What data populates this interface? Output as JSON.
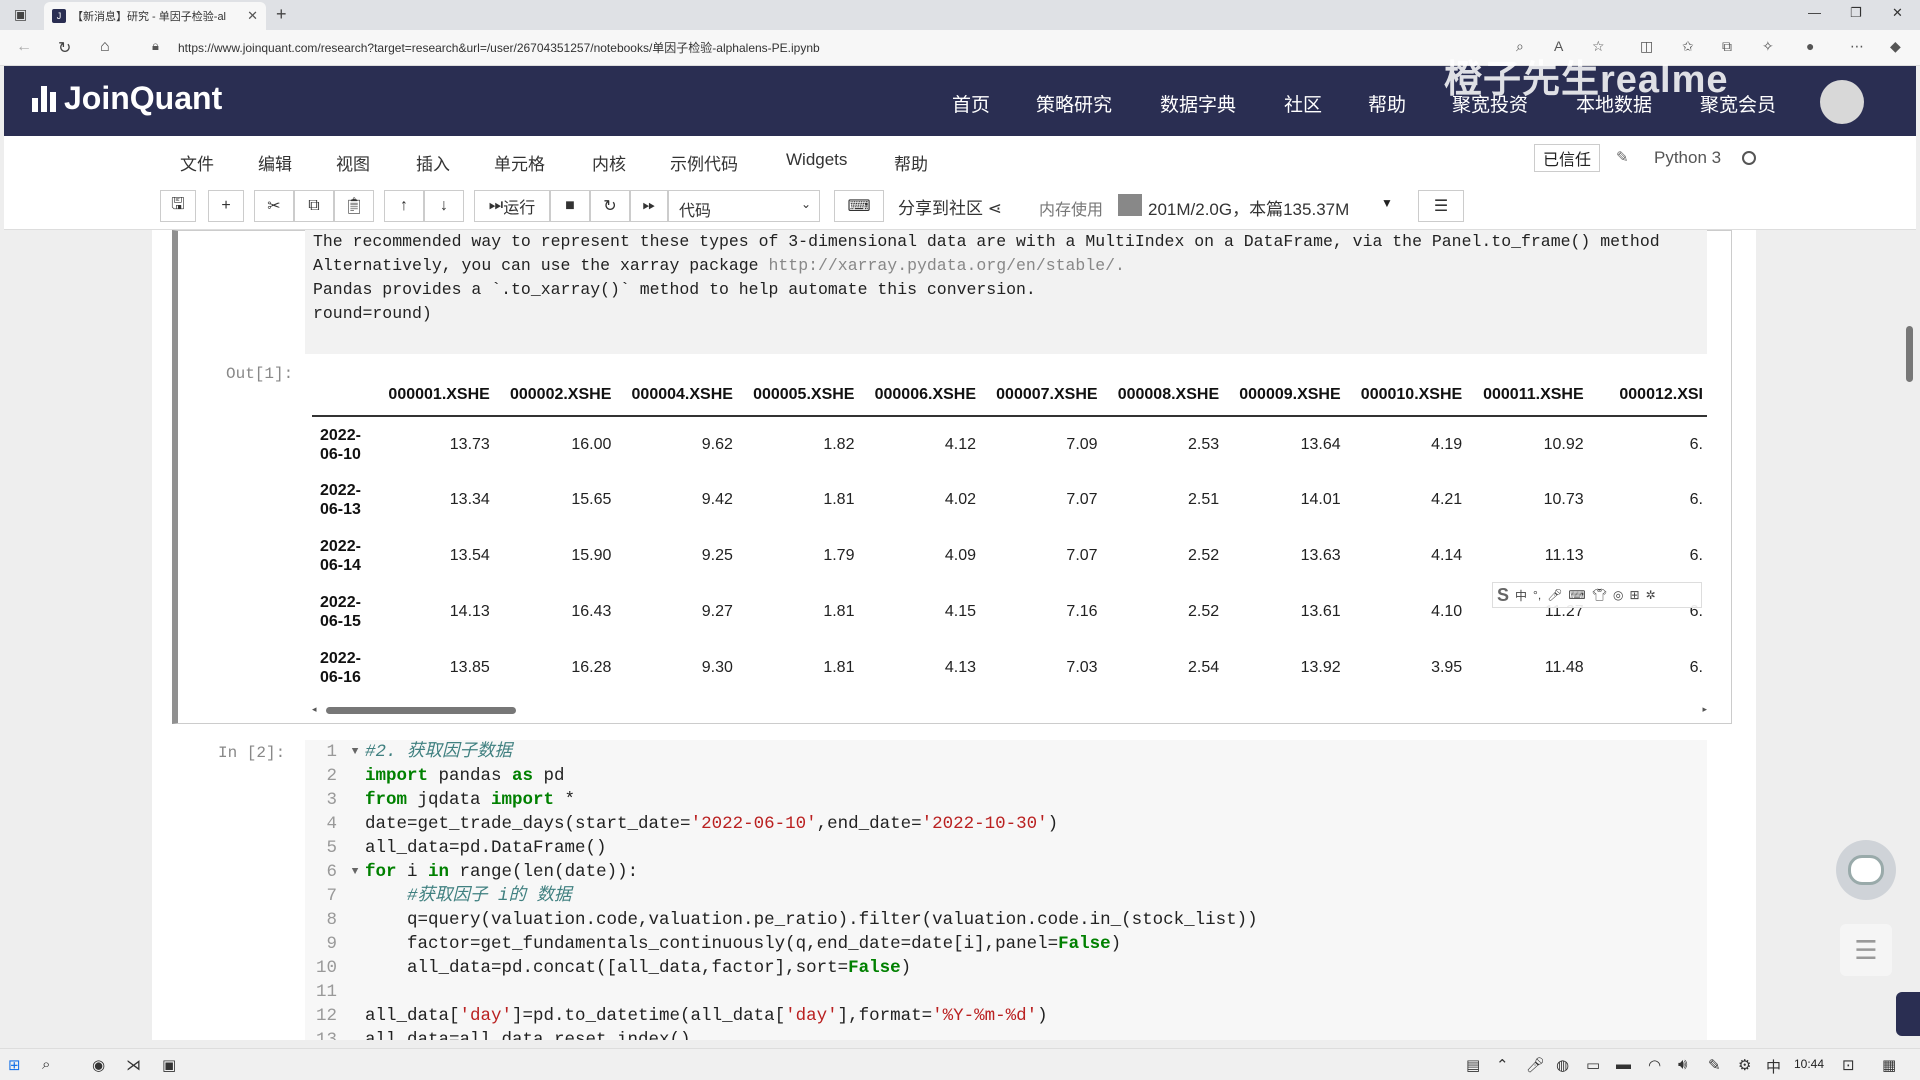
{
  "browser": {
    "tab_title": "【新消息】研究 - 单因子检验-al",
    "url": "https://www.joinquant.com/research?target=research&url=/user/26704351257/notebooks/单因子检验-alphalens-PE.ipynb"
  },
  "site": {
    "logo": "JoinQuant",
    "nav": [
      "首页",
      "策略研究",
      "数据字典",
      "社区",
      "帮助",
      "聚宽投资",
      "本地数据",
      "聚宽会员"
    ],
    "watermark": "橙子先生realme"
  },
  "menubar": {
    "items": [
      "文件",
      "编辑",
      "视图",
      "插入",
      "单元格",
      "内核",
      "示例代码",
      "Widgets",
      "帮助"
    ],
    "trusted": "已信任",
    "kernel": "Python 3"
  },
  "toolbar": {
    "run_label": "运行",
    "cell_type": "代码",
    "share_label": "分享到社区",
    "mem_label": "内存使用",
    "mem_value": "201M/2.0G，本篇135.37M"
  },
  "cell1": {
    "stderr_lines": [
      "The recommended way to represent these types of 3-dimensional data are with a MultiIndex on a DataFrame, via the Panel.to_frame() method",
      "Alternatively, you can use the xarray package ",
      "Pandas provides a `.to_xarray()` method to help automate this conversion."
    ],
    "stderr_url": "http://xarray.pydata.org/en/stable/.",
    "stderr_tail": "  round=round)",
    "out_prompt": "Out[1]:",
    "columns": [
      "000001.XSHE",
      "000002.XSHE",
      "000004.XSHE",
      "000005.XSHE",
      "000006.XSHE",
      "000007.XSHE",
      "000008.XSHE",
      "000009.XSHE",
      "000010.XSHE",
      "000011.XSHE",
      "000012.XSI"
    ],
    "rows": [
      {
        "date1": "2022-",
        "date2": "06-10",
        "values": [
          "13.73",
          "16.00",
          "9.62",
          "1.82",
          "4.12",
          "7.09",
          "2.53",
          "13.64",
          "4.19",
          "10.92",
          "6."
        ]
      },
      {
        "date1": "2022-",
        "date2": "06-13",
        "values": [
          "13.34",
          "15.65",
          "9.42",
          "1.81",
          "4.02",
          "7.07",
          "2.51",
          "14.01",
          "4.21",
          "10.73",
          "6."
        ]
      },
      {
        "date1": "2022-",
        "date2": "06-14",
        "values": [
          "13.54",
          "15.90",
          "9.25",
          "1.79",
          "4.09",
          "7.07",
          "2.52",
          "13.63",
          "4.14",
          "11.13",
          "6."
        ]
      },
      {
        "date1": "2022-",
        "date2": "06-15",
        "values": [
          "14.13",
          "16.43",
          "9.27",
          "1.81",
          "4.15",
          "7.16",
          "2.52",
          "13.61",
          "4.10",
          "11.27",
          "6."
        ]
      },
      {
        "date1": "2022-",
        "date2": "06-16",
        "values": [
          "13.85",
          "16.28",
          "9.30",
          "1.81",
          "4.13",
          "7.03",
          "2.54",
          "13.92",
          "3.95",
          "11.48",
          "6."
        ]
      }
    ]
  },
  "cell2": {
    "in_prompt": "In  [2]:",
    "lines": [
      {
        "n": "1",
        "fold": true,
        "html": "<span class=\"cm\">#2. 获取因子数据</span>"
      },
      {
        "n": "2",
        "fold": false,
        "html": "<span class=\"kw\">import</span> pandas <span class=\"kw\">as</span> pd"
      },
      {
        "n": "3",
        "fold": false,
        "html": "<span class=\"kw\">from</span> jqdata <span class=\"kw\">import</span> *"
      },
      {
        "n": "4",
        "fold": false,
        "html": "date=get_trade_days(start_date=<span class=\"st\">'2022-06-10'</span>,end_date=<span class=\"st\">'2022-10-30'</span>)"
      },
      {
        "n": "5",
        "fold": false,
        "html": "all_data=pd.DataFrame()"
      },
      {
        "n": "6",
        "fold": true,
        "html": "<span class=\"kw\">for</span> i <span class=\"kw\">in</span> range(len(date)):"
      },
      {
        "n": "7",
        "fold": false,
        "html": "    <span class=\"cm\">#获取因子 i的 数据</span>"
      },
      {
        "n": "8",
        "fold": false,
        "html": "    q=query(valuation.code,valuation.pe_ratio).filter(valuation.code.in_(stock_list))"
      },
      {
        "n": "9",
        "fold": false,
        "html": "    factor=get_fundamentals_continuously(q,end_date=date[i],panel=<span class=\"kw\">False</span>)"
      },
      {
        "n": "10",
        "fold": false,
        "html": "    all_data=pd.concat([all_data,factor],sort=<span class=\"kw\">False</span>)"
      },
      {
        "n": "11",
        "fold": false,
        "html": ""
      },
      {
        "n": "12",
        "fold": false,
        "html": "all_data[<span class=\"st\">'day'</span>]=pd.to_datetime(all_data[<span class=\"st\">'day'</span>],format=<span class=\"st\">'%Y-%m-%d'</span>)"
      },
      {
        "n": "13",
        "fold": false,
        "html": "all_data=all_data.reset_index()"
      }
    ]
  },
  "taskbar": {
    "time": "10:44"
  }
}
